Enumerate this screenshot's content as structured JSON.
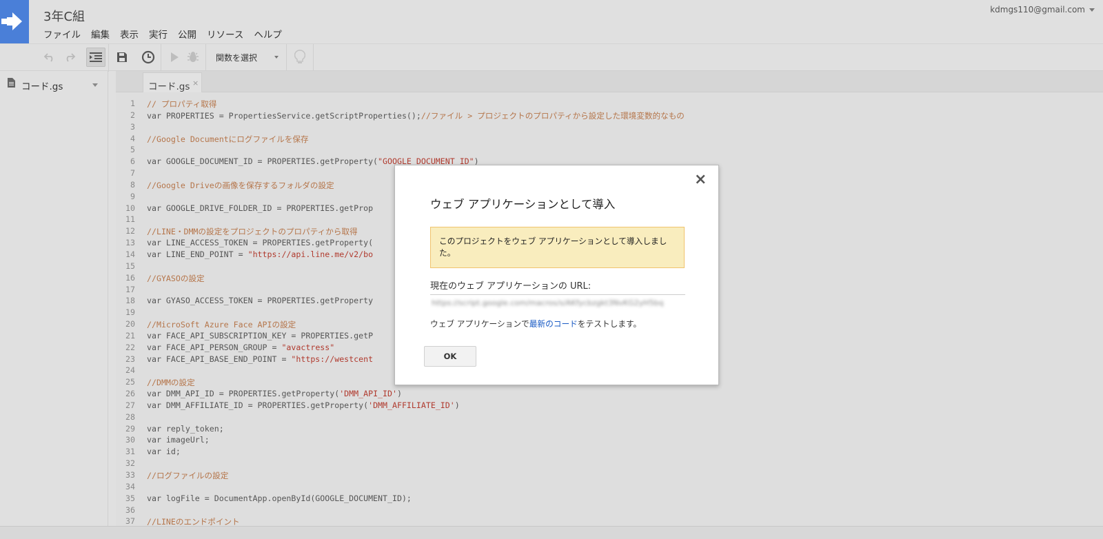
{
  "app": {
    "project_title": "3年C組",
    "account": "kdmgs110@gmail.com",
    "colors": {
      "brand_blue": "#4a7fd8",
      "comment": "#b5754a",
      "string": "#b03a2e",
      "notice_bg": "#f9edbe",
      "link": "#1a5bc4"
    }
  },
  "menu": [
    "ファイル",
    "編集",
    "表示",
    "実行",
    "公開",
    "リソース",
    "ヘルプ"
  ],
  "toolbar": {
    "icons": [
      "undo-icon",
      "redo-icon",
      "indent-icon",
      "save-icon",
      "clock-icon",
      "run-icon",
      "debug-icon",
      "lightbulb-icon"
    ],
    "function_select": "関数を選択"
  },
  "files": {
    "current": "コード.gs"
  },
  "editor": {
    "tab": "コード.gs",
    "tab_close": "×",
    "lines": [
      {
        "n": "1",
        "parts": [
          {
            "t": "// プロパティ取得",
            "c": "cm"
          }
        ]
      },
      {
        "n": "2",
        "parts": [
          {
            "t": "var PROPERTIES = PropertiesService.getScriptProperties();",
            "c": ""
          },
          {
            "t": "//ファイル > プロジェクトのプロパティから設定した環境変数的なもの",
            "c": "cm"
          }
        ]
      },
      {
        "n": "3",
        "parts": []
      },
      {
        "n": "4",
        "parts": [
          {
            "t": "//Google Documentにログファイルを保存",
            "c": "cm"
          }
        ]
      },
      {
        "n": "5",
        "parts": []
      },
      {
        "n": "6",
        "parts": [
          {
            "t": "var GOOGLE_DOCUMENT_ID = PROPERTIES.getProperty(",
            "c": ""
          },
          {
            "t": "\"GOOGLE_DOCUMENT_ID\"",
            "c": "st"
          },
          {
            "t": ")",
            "c": ""
          }
        ]
      },
      {
        "n": "7",
        "parts": []
      },
      {
        "n": "8",
        "parts": [
          {
            "t": "//Google Driveの画像を保存するフォルダの設定",
            "c": "cm"
          }
        ]
      },
      {
        "n": "9",
        "parts": []
      },
      {
        "n": "10",
        "parts": [
          {
            "t": "var GOOGLE_DRIVE_FOLDER_ID = PROPERTIES.getProp",
            "c": ""
          }
        ]
      },
      {
        "n": "11",
        "parts": []
      },
      {
        "n": "12",
        "parts": [
          {
            "t": "//LINE・DMMの設定をプロジェクトのプロパティから取得",
            "c": "cm"
          }
        ]
      },
      {
        "n": "13",
        "parts": [
          {
            "t": "var LINE_ACCESS_TOKEN = PROPERTIES.getProperty(",
            "c": ""
          }
        ]
      },
      {
        "n": "14",
        "parts": [
          {
            "t": "var LINE_END_POINT = ",
            "c": ""
          },
          {
            "t": "\"https://api.line.me/v2/bo",
            "c": "st"
          }
        ]
      },
      {
        "n": "15",
        "parts": []
      },
      {
        "n": "16",
        "parts": [
          {
            "t": "//GYASOの設定",
            "c": "cm"
          }
        ]
      },
      {
        "n": "17",
        "parts": []
      },
      {
        "n": "18",
        "parts": [
          {
            "t": "var GYASO_ACCESS_TOKEN = PROPERTIES.getProperty",
            "c": ""
          }
        ]
      },
      {
        "n": "19",
        "parts": []
      },
      {
        "n": "20",
        "parts": [
          {
            "t": "//MicroSoft Azure Face APIの設定",
            "c": "cm"
          }
        ]
      },
      {
        "n": "21",
        "parts": [
          {
            "t": "var FACE_API_SUBSCRIPTION_KEY = PROPERTIES.getP",
            "c": ""
          }
        ]
      },
      {
        "n": "22",
        "parts": [
          {
            "t": "var FACE_API_PERSON_GROUP = ",
            "c": ""
          },
          {
            "t": "\"avactress\"",
            "c": "st"
          }
        ]
      },
      {
        "n": "23",
        "parts": [
          {
            "t": "var FACE_API_BASE_END_POINT = ",
            "c": ""
          },
          {
            "t": "\"https://westcent",
            "c": "st"
          }
        ]
      },
      {
        "n": "24",
        "parts": []
      },
      {
        "n": "25",
        "parts": [
          {
            "t": "//DMMの設定",
            "c": "cm"
          }
        ]
      },
      {
        "n": "26",
        "parts": [
          {
            "t": "var DMM_API_ID = PROPERTIES.getProperty(",
            "c": ""
          },
          {
            "t": "'DMM_API_ID'",
            "c": "st"
          },
          {
            "t": ")",
            "c": ""
          }
        ]
      },
      {
        "n": "27",
        "parts": [
          {
            "t": "var DMM_AFFILIATE_ID = PROPERTIES.getProperty(",
            "c": ""
          },
          {
            "t": "'DMM_AFFILIATE_ID'",
            "c": "st"
          },
          {
            "t": ")",
            "c": ""
          }
        ]
      },
      {
        "n": "28",
        "parts": []
      },
      {
        "n": "29",
        "parts": [
          {
            "t": "var reply_token;",
            "c": ""
          }
        ]
      },
      {
        "n": "30",
        "parts": [
          {
            "t": "var imageUrl;",
            "c": ""
          }
        ]
      },
      {
        "n": "31",
        "parts": [
          {
            "t": "var id;",
            "c": ""
          }
        ]
      },
      {
        "n": "32",
        "parts": []
      },
      {
        "n": "33",
        "parts": [
          {
            "t": "//ログファイルの設定",
            "c": "cm"
          }
        ]
      },
      {
        "n": "34",
        "parts": []
      },
      {
        "n": "35",
        "parts": [
          {
            "t": "var logFile = DocumentApp.openById(GOOGLE_DOCUMENT_ID);",
            "c": ""
          }
        ]
      },
      {
        "n": "36",
        "parts": []
      },
      {
        "n": "37",
        "parts": [
          {
            "t": "//LINEのエンドポイント",
            "c": "cm"
          }
        ]
      }
    ]
  },
  "dialog": {
    "title": "ウェブ アプリケーションとして導入",
    "close": "×",
    "notice": "このプロジェクトをウェブ アプリケーションとして導入しました。",
    "url_label": "現在のウェブ アプリケーションの URL:",
    "url_value": "https://script.google.com/macros/s/AKfycbzgkt3NvKG2yH5bq",
    "test_prefix": "ウェブ アプリケーションで",
    "test_link": "最新のコード",
    "test_suffix": "をテストします。",
    "ok": "OK"
  }
}
